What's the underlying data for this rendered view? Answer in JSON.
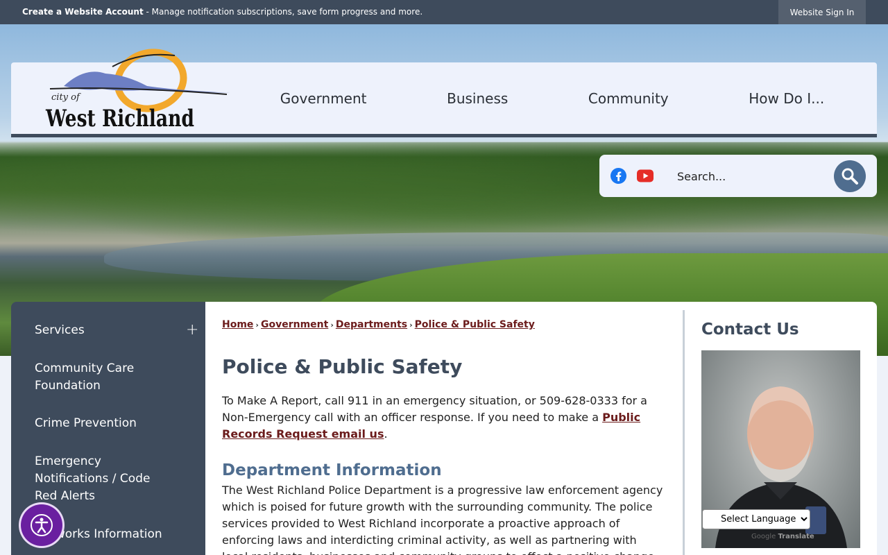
{
  "topbar": {
    "create_account": "Create a Website Account",
    "create_account_desc": " - Manage notification subscriptions, save form progress and more.",
    "sign_in": "Website Sign In"
  },
  "header": {
    "logo_top": "city of",
    "logo_name": "West Richland",
    "nav": [
      "Government",
      "Business",
      "Community",
      "How Do I..."
    ]
  },
  "search": {
    "placeholder": "Search..."
  },
  "sidebar": {
    "expand_symbol": "+",
    "items": [
      "Services",
      "Community Care Foundation",
      "Crime Prevention",
      "Emergency Notifications / Code Red Alerts",
      "Networks Information"
    ]
  },
  "breadcrumb": [
    "Home",
    "Government",
    "Departments",
    "Police & Public Safety"
  ],
  "breadcrumb_separator": "›",
  "main": {
    "title": "Police & Public Safety",
    "intro_text": "To Make A Report, call 911 in an emergency situation, or 509-628-0333 for a Non-Emergency call with an officer response. If you need to make a ",
    "intro_link": "Public Records Request email us",
    "intro_end": ".",
    "section_title": "Department Information",
    "section_body": "The West Richland Police Department is a progressive law enforcement agency which is poised for future growth with the surrounding community. The police services provided to West Richland incorporate a proactive approach of enforcing laws and interdicting criminal activity, as well as partnering with local residents, businesses and community groups to effect a positive change."
  },
  "contact": {
    "title": "Contact Us"
  },
  "translate": {
    "select_label": "Select Language",
    "powered_by": "Google",
    "translate_word": "Translate"
  },
  "colors": {
    "topbar": "#3e4b5c",
    "accent": "#4f6d8f",
    "link": "#6b1b1b",
    "a11y": "#6a1fa0"
  }
}
